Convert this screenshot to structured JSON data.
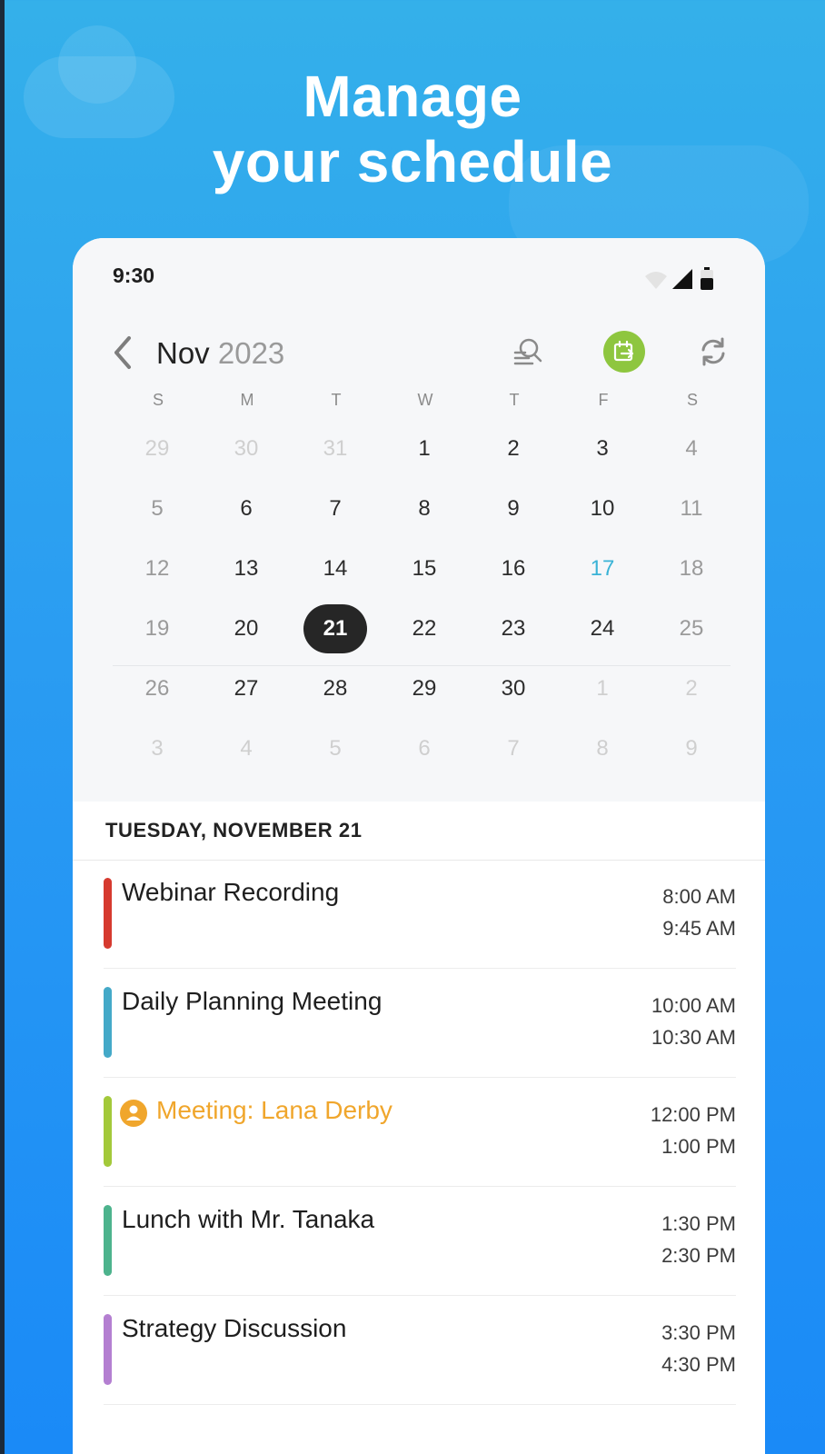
{
  "headline": {
    "line1": "Manage",
    "line2": "your schedule"
  },
  "status_bar": {
    "time": "9:30"
  },
  "calendar": {
    "month": "Nov",
    "year": "2023",
    "weekdays": [
      "S",
      "M",
      "T",
      "W",
      "T",
      "F",
      "S"
    ],
    "weeks": [
      [
        "29",
        "30",
        "31",
        "1",
        "2",
        "3",
        "4"
      ],
      [
        "5",
        "6",
        "7",
        "8",
        "9",
        "10",
        "11"
      ],
      [
        "12",
        "13",
        "14",
        "15",
        "16",
        "17",
        "18"
      ],
      [
        "19",
        "20",
        "21",
        "22",
        "23",
        "24",
        "25"
      ],
      [
        "26",
        "27",
        "28",
        "29",
        "30",
        "1",
        "2"
      ],
      [
        "3",
        "4",
        "5",
        "6",
        "7",
        "8",
        "9"
      ]
    ],
    "selected_date": "21",
    "today_date": "17",
    "accent_color": "#8ec63f",
    "today_color": "#3ab3d6"
  },
  "agenda": {
    "date_header": "TUESDAY, NOVEMBER 21",
    "events": [
      {
        "title": "Webinar Recording",
        "start": "8:00 AM",
        "end": "9:45 AM",
        "color": "#d63a2f"
      },
      {
        "title": "Daily Planning Meeting",
        "start": "10:00 AM",
        "end": "10:30 AM",
        "color": "#44a9c8"
      },
      {
        "title": "Meeting: Lana Derby",
        "start": "12:00 PM",
        "end": "1:00 PM",
        "color": "#a3c93a",
        "title_color": "#f0a62c",
        "icon": "person-icon"
      },
      {
        "title": "Lunch with Mr. Tanaka",
        "start": "1:30 PM",
        "end": "2:30 PM",
        "color": "#4db38d"
      },
      {
        "title": "Strategy Discussion",
        "start": "3:30 PM",
        "end": "4:30 PM",
        "color": "#b47fd1"
      }
    ]
  }
}
